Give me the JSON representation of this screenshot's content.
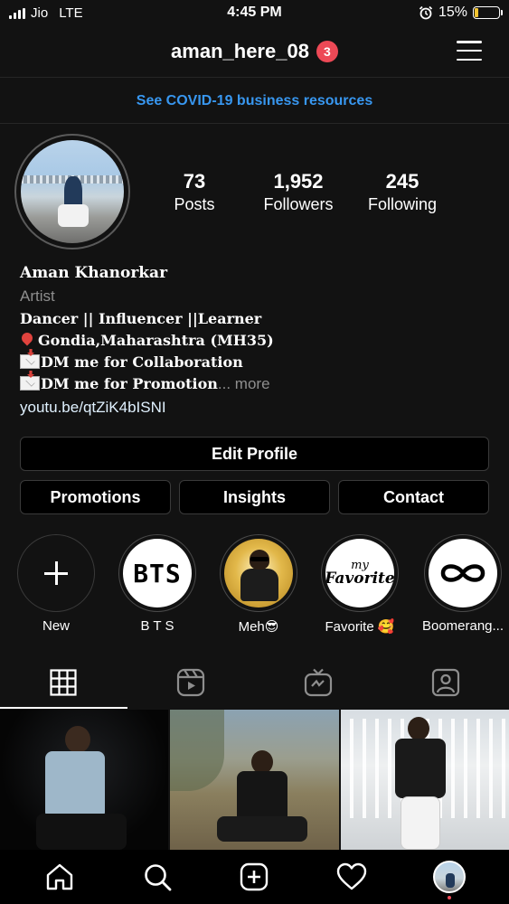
{
  "status_bar": {
    "carrier": "Jio",
    "network": "LTE",
    "time": "4:45 PM",
    "battery": "15%",
    "battery_level": 0.15,
    "icons": [
      "signal-icon",
      "alarm-icon",
      "battery-icon"
    ]
  },
  "header": {
    "username": "aman_here_08",
    "notification_count": "3",
    "menu_icon": "hamburger-menu-icon"
  },
  "banner": {
    "text": "See COVID-19 business resources",
    "color": "#3897f0"
  },
  "profile": {
    "stats": [
      {
        "value": "73",
        "label": "Posts"
      },
      {
        "value": "1,952",
        "label": "Followers"
      },
      {
        "value": "245",
        "label": "Following"
      }
    ],
    "name": "Aman Khanorkar",
    "category": "Artist",
    "bio": {
      "line1": "Dancer || Influencer ||Learner",
      "line2": "Gondia,Maharashtra (MH35)",
      "line3": "DM me for Collaboration",
      "line4": "DM me for Promotion",
      "more": "... more"
    },
    "link": "youtu.be/qtZiK4bISNI"
  },
  "buttons": {
    "edit_profile": "Edit Profile",
    "promotions": "Promotions",
    "insights": "Insights",
    "contact": "Contact"
  },
  "highlights": [
    {
      "label": "New",
      "icon": "plus-icon"
    },
    {
      "label": "B T S",
      "cover_text": "BTS"
    },
    {
      "label": "Meh😎"
    },
    {
      "label": "Favorite 🥰",
      "cover_text_top": "my",
      "cover_text_bottom": "Favorite"
    },
    {
      "label": "Boomerang...",
      "icon": "infinity-icon"
    }
  ],
  "tabs": [
    {
      "name": "posts-grid",
      "icon": "grid-icon",
      "active": true
    },
    {
      "name": "reels",
      "icon": "reels-icon",
      "active": false
    },
    {
      "name": "igtv",
      "icon": "igtv-icon",
      "active": false
    },
    {
      "name": "tagged",
      "icon": "tagged-icon",
      "active": false
    }
  ],
  "bottom_nav": [
    {
      "icon": "home-icon"
    },
    {
      "icon": "search-icon"
    },
    {
      "icon": "new-post-icon"
    },
    {
      "icon": "activity-heart-icon"
    },
    {
      "icon": "profile-avatar-icon"
    }
  ],
  "colors": {
    "background": "#121212",
    "notification_badge": "#ed4956",
    "link": "#e0f1ff",
    "muted_text": "#8e8e8e"
  }
}
